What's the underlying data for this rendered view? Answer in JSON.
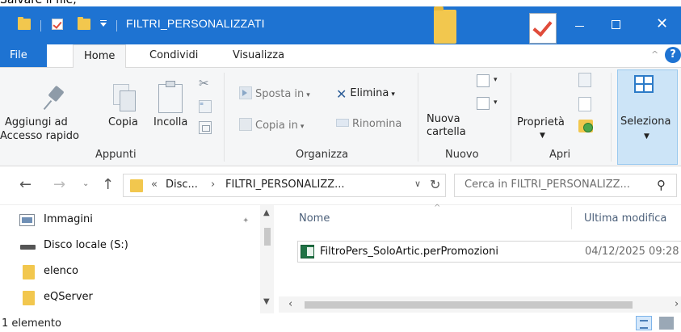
{
  "caption": "Salvare il file,",
  "window": {
    "title": "FILTRI_PERSONALIZZATI",
    "controls": {
      "minimize": "—",
      "maximize": "□",
      "close": "✕"
    }
  },
  "tabs": [
    "File",
    "Home",
    "Condividi",
    "Visualizza"
  ],
  "ribbon": {
    "appunti": {
      "label": "Appunti",
      "pin_line1": "Aggiungi ad",
      "pin_line2": "Accesso rapido",
      "copy": "Copia",
      "paste": "Incolla"
    },
    "organizza": {
      "label": "Organizza",
      "move_to": "Sposta in",
      "copy_to": "Copia in",
      "delete": "Elimina",
      "rename": "Rinomina"
    },
    "nuovo": {
      "label": "Nuovo",
      "new_folder_line1": "Nuova",
      "new_folder_line2": "cartella"
    },
    "apri": {
      "label": "Apri",
      "properties": "Proprietà"
    },
    "seleziona": {
      "label": "Seleziona"
    }
  },
  "address": {
    "prefix": "«",
    "crumb1": "Disc...",
    "separator": "›",
    "crumb2": "FILTRI_PERSONALIZZ..."
  },
  "search": {
    "placeholder": "Cerca in FILTRI_PERSONALIZZ..."
  },
  "nav": {
    "items": [
      {
        "label": "Immagini",
        "icon": "pictures-icon"
      },
      {
        "label": "Disco locale (S:)",
        "icon": "drive-icon"
      },
      {
        "label": "elenco",
        "icon": "folder-icon"
      },
      {
        "label": "eQServer",
        "icon": "folder-icon"
      }
    ]
  },
  "files": {
    "columns": [
      "Nome",
      "Ultima modifica"
    ],
    "rows": [
      {
        "name": "FiltroPers_SoloArtic.perPromozioni",
        "modified": "04/12/2025 09:28"
      }
    ]
  },
  "status": {
    "count": "1 elemento"
  },
  "colors": {
    "titlebar": "#1e73d2",
    "ribbon_bg": "#f5f6f7",
    "select_highlight": "#cce4f7",
    "folder": "#f2c74e"
  }
}
